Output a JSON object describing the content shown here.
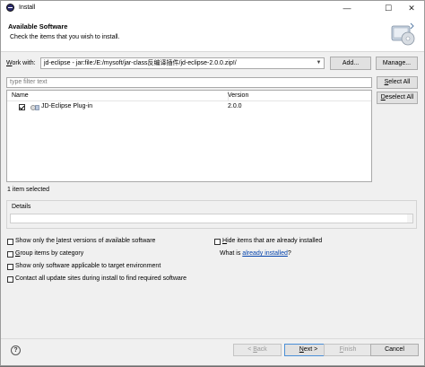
{
  "window": {
    "title": "Install",
    "controls": {
      "minimize": "—",
      "maximize": "☐",
      "close": "✕"
    }
  },
  "header": {
    "title": "Available Software",
    "description": "Check the items that you wish to install."
  },
  "work_with": {
    "label_prefix": "",
    "label_mnemonic": "W",
    "label_rest": "ork with:",
    "value": "jd-eclipse - jar:file:/E:/mysoft/jar-class反编译插件/jd-eclipse-2.0.0.zip!/",
    "add_label": "Add...",
    "manage_label": "Manage..."
  },
  "filter": {
    "placeholder": "type filter text"
  },
  "buttons": {
    "select_all": {
      "mnemonic": "S",
      "rest": "elect All"
    },
    "deselect_all": {
      "mnemonic": "D",
      "rest": "eselect All"
    }
  },
  "table": {
    "columns": [
      "Name",
      "Version"
    ],
    "rows": [
      {
        "name": "JD-Eclipse Plug-in",
        "version": "2.0.0",
        "checked": true
      }
    ]
  },
  "status": "1 item selected",
  "details": {
    "label": "Details"
  },
  "options": {
    "latest_pre": "Show only the ",
    "latest_mn": "l",
    "latest_post": "atest versions of available software",
    "group_pre": "",
    "group_mn": "G",
    "group_post": "roup items by category",
    "target": "Show only software applicable to target environment",
    "contact": "Contact all update sites during install to find required software",
    "hide_pre": "",
    "hide_mn": "H",
    "hide_post": "ide items that are already installed",
    "what_is_pre": "What is ",
    "what_is_link": "already installed",
    "what_is_post": "?"
  },
  "footer": {
    "help": "?",
    "back": {
      "pre": "< ",
      "mn": "B",
      "post": "ack"
    },
    "next": {
      "pre": "",
      "mn": "N",
      "post": "ext >"
    },
    "finish": {
      "pre": "",
      "mn": "F",
      "post": "inish"
    },
    "cancel": "Cancel"
  },
  "colors": {
    "link": "#0645ad",
    "default_button_border": "#4a8fd6"
  }
}
